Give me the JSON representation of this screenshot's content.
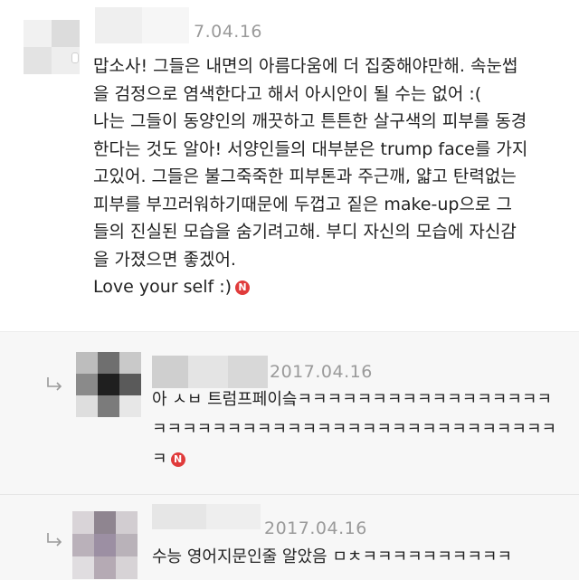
{
  "comments": [
    {
      "date": "7.04.16",
      "text": "맙소사! 그들은 내면의 아름다움에 더 집중해야만해. 속눈썹\n을 검정으로 염색한다고 해서 아시안이 될 수는 없어 :(\n나는 그들이 동양인의 깨끗하고 튼튼한 살구색의 피부를 동경\n한다는 것도 알아! 서양인들의 대부분은 trump face를 가지\n고있어. 그들은 불그죽죽한 피부톤과 주근깨, 얇고 탄력없는\n피부를 부끄러워하기때문에 두껍고 짙은 make-up으로 그\n들의 진실된 모습을 숨기려고해. 부디 자신의 모습에 자신감\n을 가졌으면 좋겠어.\nLove your self :)",
      "badge": "N"
    },
    {
      "date": "2017.04.16",
      "text": "아 ㅅㅂ 트럼프페이슼ㅋㅋㅋㅋㅋㅋㅋㅋㅋㅋㅋㅋㅋㅋㅋㅋㅋㅋㅋㅋㅋㅋㅋㅋㅋㅋㅋㅋㅋㅋㅋㅋㅋㅋㅋㅋㅋㅋㅋㅋㅋㅋㅋㅋㅋ",
      "badge": "N"
    },
    {
      "date": "2017.04.16",
      "text": "수능 영어지문인줄 알았음 ㅁㅊㅋㅋㅋㅋㅋㅋㅋㅋㅋㅋ"
    }
  ],
  "colors": {
    "badge": "#e03b3b",
    "meta": "#9a9a9a",
    "reply_bg": "#f7f7f7"
  },
  "icons": {
    "reply": "reply-arrow-icon",
    "new": "new-badge-icon",
    "avatar": "blurred-avatar"
  }
}
